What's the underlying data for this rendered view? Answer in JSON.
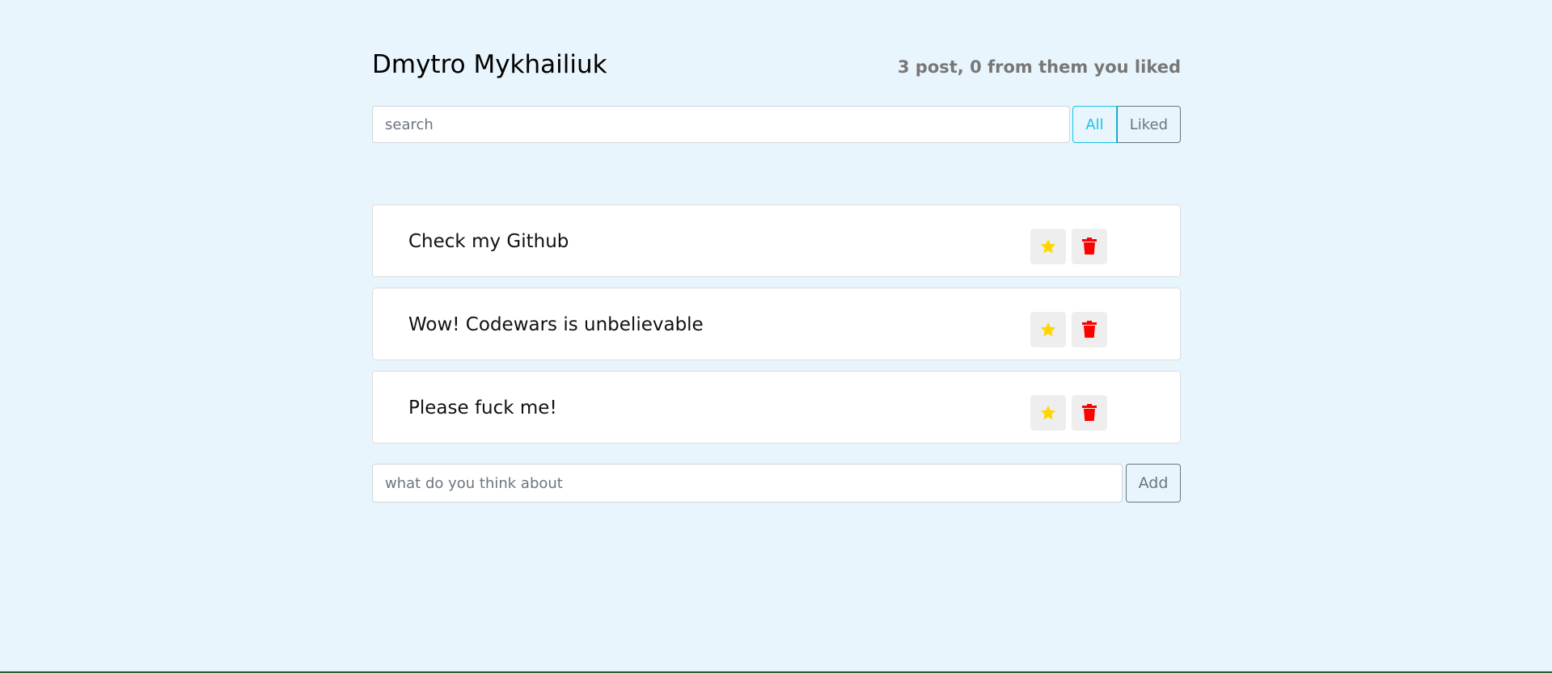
{
  "header": {
    "title": "Dmytro Mykhailiuk",
    "summary": "3 post, 0 from them you liked"
  },
  "search": {
    "placeholder": "search",
    "value": ""
  },
  "filters": {
    "all": "All",
    "liked": "Liked",
    "active": "All"
  },
  "posts": [
    {
      "label": "Check my Github",
      "liked": false
    },
    {
      "label": "Wow! Codewars is unbelievable",
      "liked": false
    },
    {
      "label": "Please fuck me!",
      "liked": false
    }
  ],
  "add_form": {
    "placeholder": "what do you think about",
    "button": "Add"
  },
  "colors": {
    "background": "#e9f5fc",
    "star": "#ffd700",
    "trash": "#ff0000",
    "active_filter": "#17c3e8"
  }
}
